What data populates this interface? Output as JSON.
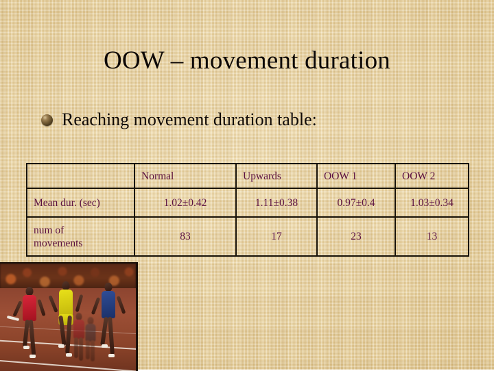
{
  "slide": {
    "title": "OOW – movement duration",
    "bullet": {
      "icon": "sphere-bullet",
      "text": "Reaching movement duration table:"
    },
    "background_color": "#e9d49b",
    "title_color": "#0d0806",
    "table_text_color": "#5b1040",
    "table_border_color": "#181208"
  },
  "table": {
    "corner_label": "",
    "columns": [
      "Normal",
      "Upwards",
      "OOW 1",
      "OOW 2"
    ],
    "rows": [
      {
        "label": "Mean dur. (sec)",
        "label_line1": "Mean dur. (sec)",
        "label_line2": "",
        "values": [
          "1.02±0.42",
          "1.11±0.38",
          "0.97±0.4",
          "1.03±0.34"
        ]
      },
      {
        "label": "num of movements",
        "label_line1": "num of",
        "label_line2": "movements",
        "values": [
          "83",
          "17",
          "23",
          "13"
        ]
      }
    ]
  },
  "photo": {
    "caption": "",
    "description": "sprinters-relay-race-photo"
  }
}
